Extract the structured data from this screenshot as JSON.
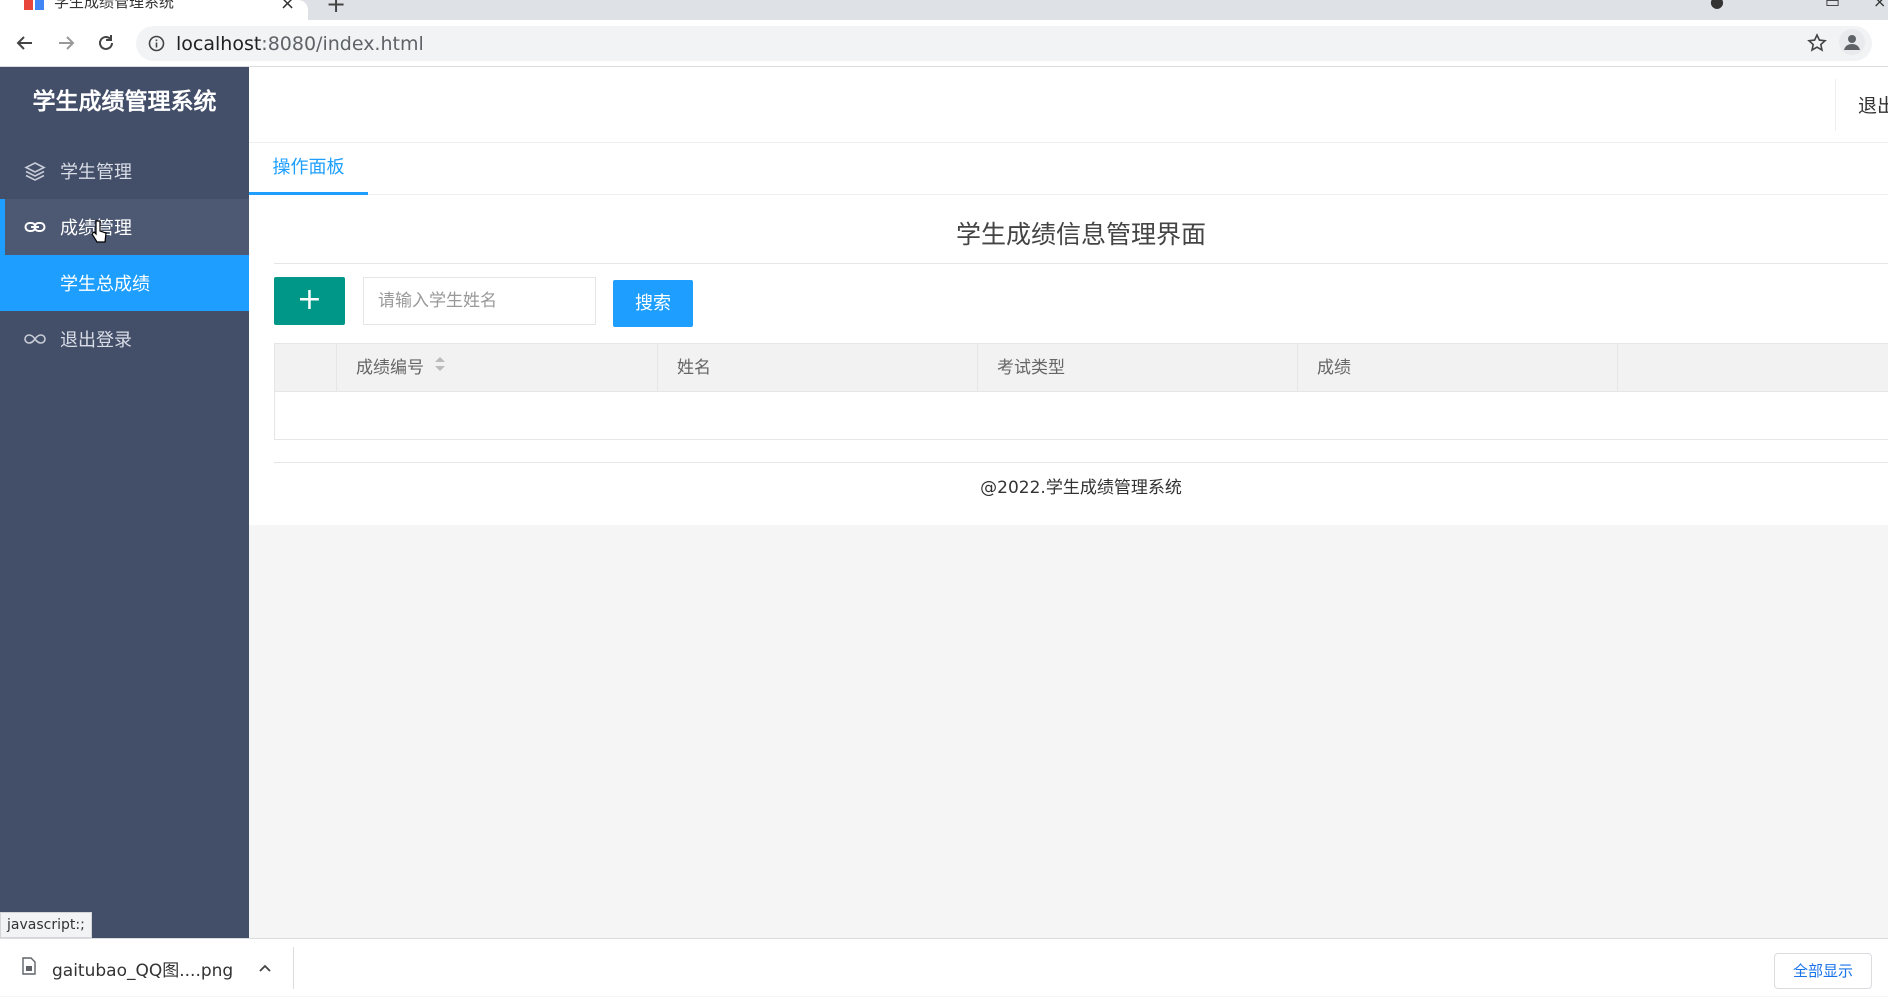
{
  "browser": {
    "tab_title": "学生成绩管理系统",
    "url_host": "localhost",
    "url_path": ":8080/index.html",
    "status_tip": "javascript:;"
  },
  "sidebar": {
    "logo": "学生成绩管理系统",
    "items": [
      {
        "label": "学生管理",
        "icon": "layers-icon"
      },
      {
        "label": "成绩管理",
        "icon": "link-icon"
      },
      {
        "label": "学生总成绩",
        "icon": ""
      },
      {
        "label": "退出登录",
        "icon": "loop-icon"
      }
    ]
  },
  "header": {
    "logout": "退出"
  },
  "tabs": {
    "panel": "操作面板"
  },
  "main": {
    "title": "学生成绩信息管理界面",
    "add_label": "+",
    "search_placeholder": "请输入学生姓名",
    "search_button": "搜索",
    "columns": [
      "成绩编号",
      "姓名",
      "考试类型",
      "成绩"
    ],
    "footer": "@2022.学生成绩管理系统"
  },
  "downloads": {
    "file_name": "gaitubao_QQ图....png",
    "show_all": "全部显示"
  },
  "colors": {
    "sidebar_bg": "#434e69",
    "primary_blue": "#1e9fff",
    "add_green": "#009688"
  }
}
